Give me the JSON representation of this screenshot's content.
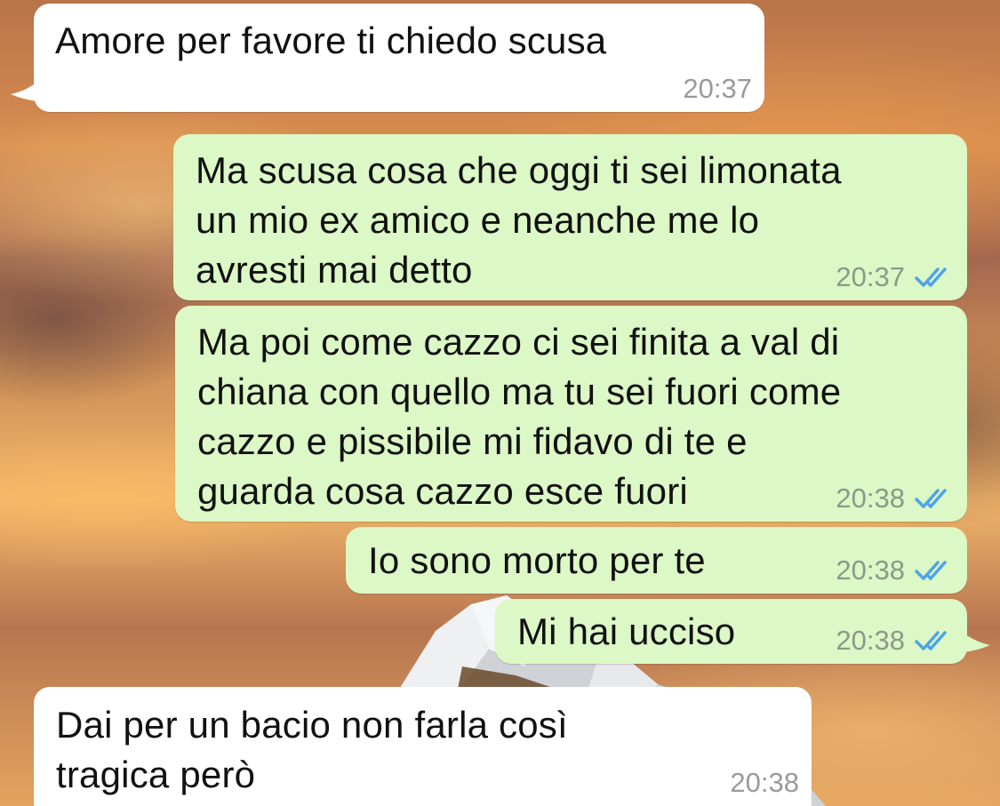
{
  "messages": [
    {
      "direction": "incoming",
      "text": "Amore per favore ti chiedo scusa",
      "time": "20:37"
    },
    {
      "direction": "outgoing",
      "text": "Ma scusa cosa che oggi ti sei limonata\nun mio ex amico e neanche me lo\navresti mai detto",
      "time": "20:37",
      "status": "read"
    },
    {
      "direction": "outgoing",
      "text": "Ma poi come cazzo ci sei finita a val di\nchiana con quello ma tu sei fuori come\ncazzo e pissibile mi fidavo di te e\nguarda cosa cazzo esce fuori",
      "time": "20:38",
      "status": "read"
    },
    {
      "direction": "outgoing",
      "text": "Io sono morto per te",
      "time": "20:38",
      "status": "read"
    },
    {
      "direction": "outgoing",
      "text": "Mi hai ucciso",
      "time": "20:38",
      "status": "read"
    },
    {
      "direction": "incoming",
      "text": "Dai per un bacio non farla così\ntragica però",
      "time": "20:38"
    }
  ],
  "colors": {
    "incoming_bubble": "#ffffff",
    "outgoing_bubble": "#dcf8c6",
    "read_check": "#4fa3e8",
    "timestamp": "#8a9a8a"
  },
  "icons": {
    "read_receipt": "double-check-icon"
  }
}
